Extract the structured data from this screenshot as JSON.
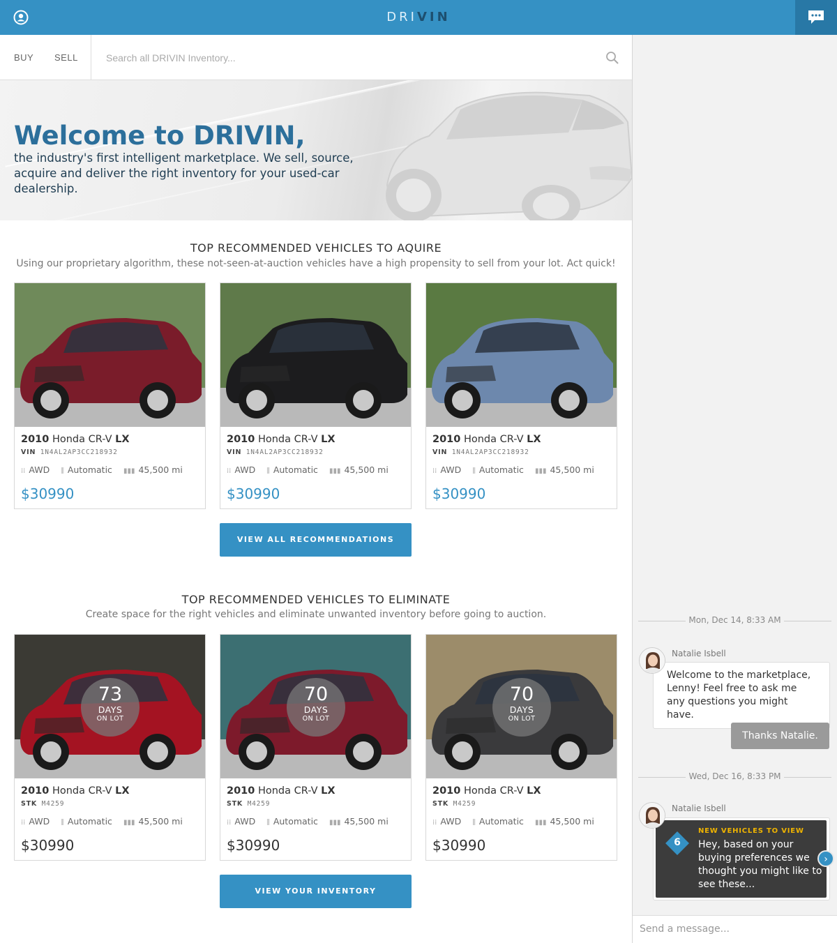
{
  "app": {
    "logo_left": "DRI",
    "logo_right": "VIN"
  },
  "nav": {
    "buy_label": "BUY",
    "sell_label": "SELL",
    "search_placeholder": "Search all DRIVIN Inventory..."
  },
  "hero": {
    "title": "Welcome to DRIVIN,",
    "subtitle": "the industry's first intelligent marketplace. We sell, source, acquire and deliver the right inventory for your used-car dealership."
  },
  "acquire": {
    "title": "TOP RECOMMENDED VEHICLES TO AQUIRE",
    "subtitle": "Using our proprietary algorithm, these not-seen-at-auction vehicles have a high propensity to sell from your lot. Act quick!",
    "button_label": "VIEW ALL RECOMMENDATIONS",
    "cards": [
      {
        "year": "2010",
        "model": "Honda CR-V",
        "trim": "LX",
        "code_label": "VIN",
        "code": "1N4AL2AP3CC218932",
        "drive": "AWD",
        "transmission": "Automatic",
        "mileage": "45,500 mi",
        "price": "$30990",
        "color": "#7a1c2a"
      },
      {
        "year": "2010",
        "model": "Honda CR-V",
        "trim": "LX",
        "code_label": "VIN",
        "code": "1N4AL2AP3CC218932",
        "drive": "AWD",
        "transmission": "Automatic",
        "mileage": "45,500 mi",
        "price": "$30990",
        "color": "#1c1c1e"
      },
      {
        "year": "2010",
        "model": "Honda CR-V",
        "trim": "LX",
        "code_label": "VIN",
        "code": "1N4AL2AP3CC218932",
        "drive": "AWD",
        "transmission": "Automatic",
        "mileage": "45,500 mi",
        "price": "$30990",
        "color": "#6d88ad"
      }
    ]
  },
  "eliminate": {
    "title": "TOP RECOMMENDED VEHICLES TO ELIMINATE",
    "subtitle": "Create space for the right vehicles and eliminate unwanted inventory before going to auction.",
    "button_label": "VIEW YOUR INVENTORY",
    "cards": [
      {
        "year": "2010",
        "model": "Honda CR-V",
        "trim": "LX",
        "code_label": "STK",
        "code": "M4259",
        "drive": "AWD",
        "transmission": "Automatic",
        "mileage": "45,500 mi",
        "price": "$30990",
        "days": "73",
        "days_label": "DAYS",
        "on_lot_label": "ON LOT",
        "color": "#a41322"
      },
      {
        "year": "2010",
        "model": "Honda CR-V",
        "trim": "LX",
        "code_label": "STK",
        "code": "M4259",
        "drive": "AWD",
        "transmission": "Automatic",
        "mileage": "45,500 mi",
        "price": "$30990",
        "days": "70",
        "days_label": "DAYS",
        "on_lot_label": "ON LOT",
        "color": "#7d1a2b"
      },
      {
        "year": "2010",
        "model": "Honda CR-V",
        "trim": "LX",
        "code_label": "STK",
        "code": "M4259",
        "drive": "AWD",
        "transmission": "Automatic",
        "mileage": "45,500 mi",
        "price": "$30990",
        "days": "70",
        "days_label": "DAYS",
        "on_lot_label": "ON LOT",
        "color": "#3a3a3c"
      }
    ]
  },
  "chat": {
    "separator_1": "Mon, Dec 14, 8:33 AM",
    "sender_1": "Natalie Isbell",
    "message_1": "Welcome to the marketplace, Lenny! Feel free to ask me any questions you might have.",
    "reply_1": "Thanks Natalie.",
    "separator_2": "Wed, Dec 16, 8:33 PM",
    "sender_2": "Natalie Isbell",
    "promo_count": "6",
    "promo_title": "NEW VEHICLES TO VIEW",
    "promo_text": "Hey, based on your buying preferences we thought you might like to see these...",
    "composer_placeholder": "Send a message..."
  },
  "colors": {
    "accent": "#3591c4",
    "promo_title": "#f0b400"
  }
}
